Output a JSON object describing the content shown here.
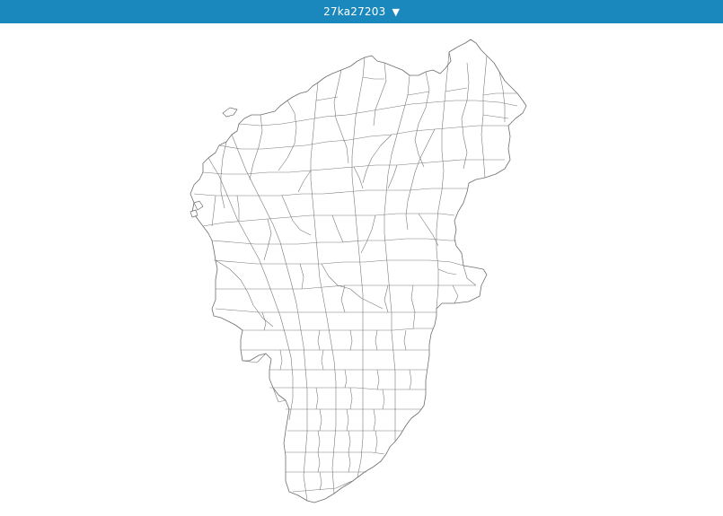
{
  "header": {
    "selector_label": "27ka27203",
    "dropdown_icon": "caret-down-icon",
    "background_color": "#1a88bd",
    "text_color": "#ffffff"
  },
  "map": {
    "fill_color": "#ffffff",
    "boundary_color": "#7a7a7a",
    "style": "administrative subdivision boundaries (no labels)"
  }
}
